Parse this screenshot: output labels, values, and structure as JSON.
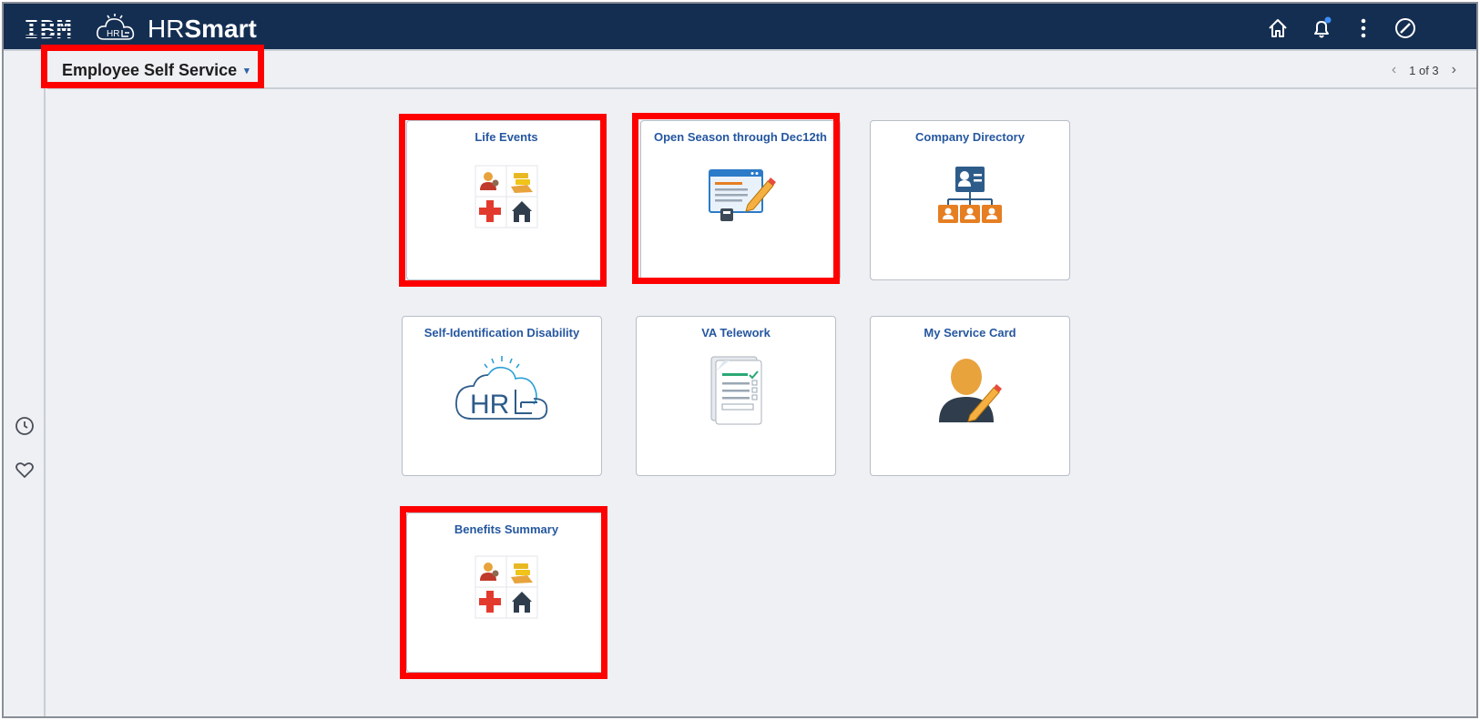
{
  "header": {
    "brand_logo": "IBM",
    "app_name_prefix": "HR",
    "app_name_suffix": "Smart",
    "icons": [
      "home-icon",
      "bell-icon",
      "more-vertical-icon",
      "navbar-compass-icon"
    ],
    "notification_dot_color": "#3d8ef7",
    "bar_color": "#142e52"
  },
  "homepage": {
    "selected": "Employee Self Service",
    "caret": "▾"
  },
  "pager": {
    "text": "1 of 3",
    "prev": "‹",
    "next": "›"
  },
  "left_rail": {
    "icons": [
      "recent-clock-icon",
      "favorites-heart-icon"
    ]
  },
  "tiles": [
    {
      "title": "Life Events",
      "icon": "benefits-grid-icon",
      "highlighted": true
    },
    {
      "title": "Open Season through Dec12th",
      "icon": "form-edit-icon",
      "highlighted": true
    },
    {
      "title": "Company Directory",
      "icon": "org-chart-icon",
      "highlighted": false
    },
    {
      "title": "Self-Identification Disability",
      "icon": "hr-cloud-icon",
      "highlighted": false
    },
    {
      "title": "VA Telework",
      "icon": "checklist-document-icon",
      "highlighted": false
    },
    {
      "title": "My Service Card",
      "icon": "person-edit-icon",
      "highlighted": false
    },
    {
      "title": "Benefits Summary",
      "icon": "benefits-grid-icon",
      "highlighted": true
    }
  ],
  "colors": {
    "highlight": "#ff0000",
    "tile_title": "#2557a0",
    "page_background": "#eef0f4"
  }
}
